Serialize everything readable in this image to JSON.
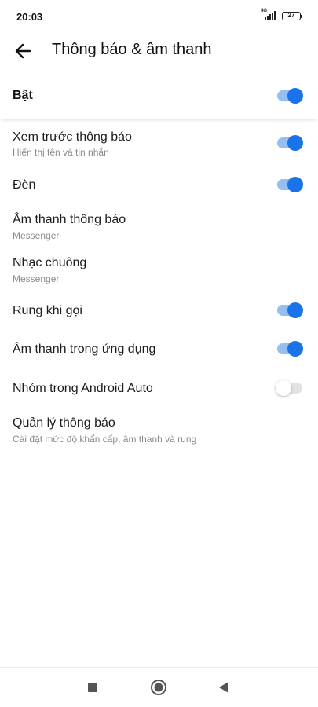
{
  "status_bar": {
    "time": "20:03",
    "network": "4G",
    "battery": "27"
  },
  "header": {
    "back_icon": "arrow-left-icon",
    "title": "Thông báo & âm thanh"
  },
  "master": {
    "label": "Bật",
    "enabled": true
  },
  "settings": [
    {
      "title": "Xem trước thông báo",
      "subtitle": "Hiển thị tên và tin nhắn",
      "toggle": true
    },
    {
      "title": "Đèn",
      "subtitle": "",
      "toggle": true
    },
    {
      "title": "Âm thanh thông báo",
      "subtitle": "Messenger",
      "toggle": null
    },
    {
      "title": "Nhạc chuông",
      "subtitle": "Messenger",
      "toggle": null
    },
    {
      "title": "Rung khi gọi",
      "subtitle": "",
      "toggle": true
    },
    {
      "title": "Âm thanh trong ứng dụng",
      "subtitle": "",
      "toggle": true
    },
    {
      "title": "Nhóm trong Android Auto",
      "subtitle": "",
      "toggle": false
    },
    {
      "title": "Quản lý thông báo",
      "subtitle": "Cài đặt mức độ khẩn cấp, âm thanh và rung",
      "toggle": null
    }
  ],
  "nav_bar": {
    "items": [
      "recents-square-icon",
      "home-circle-icon",
      "back-triangle-icon"
    ]
  },
  "colors": {
    "accent": "#1a73e8",
    "accent_track": "#94bff0",
    "off_track": "#e3e3e3"
  }
}
